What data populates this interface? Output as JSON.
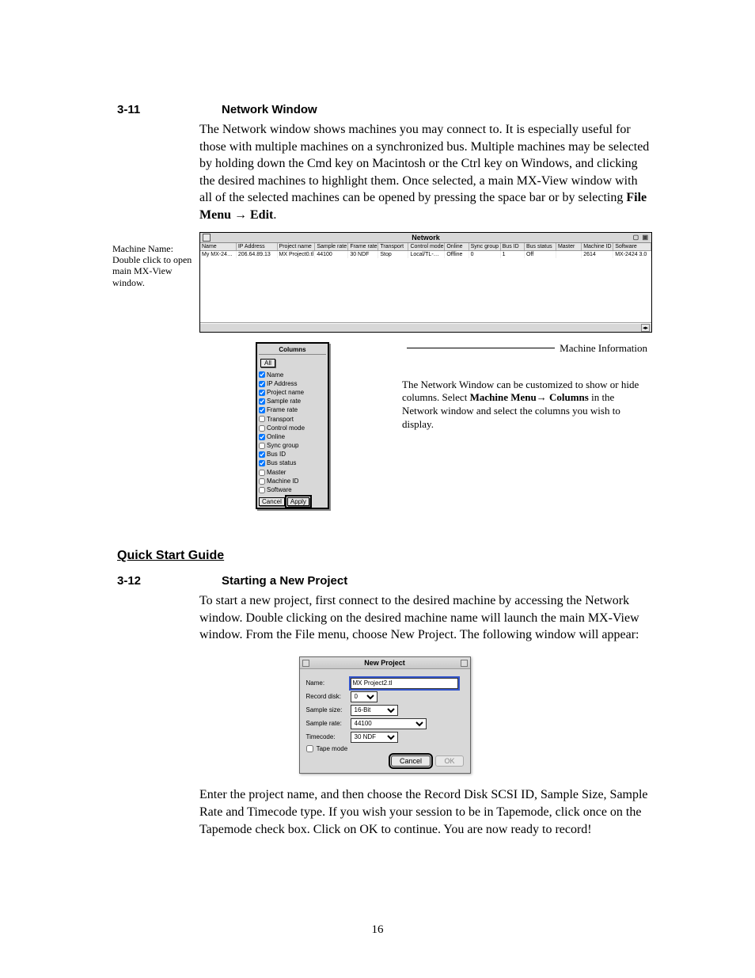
{
  "sec311": {
    "num": "3-11",
    "title": "Network Window"
  },
  "p311": "The Network window shows machines you may connect to. It is especially useful for those with multiple machines on a synchronized bus. Multiple machines may be selected by holding down the Cmd key on Macintosh or the Ctrl key on Windows, and clicking the desired machines to highlight them. Once selected, a main MX-View window with all of the selected machines can be opened by pressing the space bar or by selecting ",
  "p311_b1": "File Menu ",
  "p311_b2": " Edit",
  "arrow": "→",
  "annot": {
    "l1": "Machine Name:",
    "l2": "Double click to open",
    "l3": "main MX-View window."
  },
  "network": {
    "title": "Network",
    "headers": [
      "Name",
      "IP Address",
      "Project name",
      "Sample rate",
      "Frame rate",
      "Transport",
      "Control mode",
      "Online",
      "Sync group",
      "Bus ID",
      "Bus status",
      "Master",
      "Machine ID",
      "Software"
    ],
    "row": [
      "My MX-24…",
      "206.64.89.13",
      "MX Project0.tl",
      "44100",
      "30 NDF",
      "Stop",
      "Local/TL-…",
      "Offline",
      "0",
      "1",
      "Off",
      "",
      "2614",
      "MX-2424 3.0"
    ]
  },
  "columns": {
    "title": "Columns",
    "all": "All",
    "items": [
      {
        "label": "Name",
        "checked": true
      },
      {
        "label": "IP Address",
        "checked": true
      },
      {
        "label": "Project name",
        "checked": true
      },
      {
        "label": "Sample rate",
        "checked": true
      },
      {
        "label": "Frame rate",
        "checked": true
      },
      {
        "label": "Transport",
        "checked": false
      },
      {
        "label": "Control mode",
        "checked": false
      },
      {
        "label": "Online",
        "checked": true
      },
      {
        "label": "Sync group",
        "checked": false
      },
      {
        "label": "Bus ID",
        "checked": true
      },
      {
        "label": "Bus status",
        "checked": true
      },
      {
        "label": "Master",
        "checked": false
      },
      {
        "label": "Machine ID",
        "checked": false
      },
      {
        "label": "Software",
        "checked": false
      }
    ],
    "cancel": "Cancel",
    "apply": "Apply"
  },
  "machine_info": {
    "title": "Machine Information",
    "body_a": "The Network Window can be customized to show or hide columns. Select ",
    "body_b": "Machine Menu",
    "body_c": " Columns",
    "body_d": " in the Network window and select the columns you wish to display."
  },
  "guide_title": "Quick Start Guide",
  "sec312": {
    "num": "3-12",
    "title": "Starting a New Project"
  },
  "p312a": "To start a new project, first connect to the desired machine by accessing the Network window. Double clicking on the desired machine name will launch the main MX-View window. From the File menu, choose New Project. The following window will appear:",
  "new_project": {
    "title": "New Project",
    "name_lbl": "Name:",
    "name_val": "MX Project2.tl",
    "disk_lbl": "Record disk:",
    "disk_val": "0",
    "size_lbl": "Sample size:",
    "size_val": "16-Bit",
    "rate_lbl": "Sample rate:",
    "rate_val": "44100",
    "tc_lbl": "Timecode:",
    "tc_val": "30 NDF",
    "tape_lbl": "Tape mode",
    "cancel": "Cancel",
    "ok": "OK"
  },
  "p312b": "Enter the project name, and then choose the Record Disk SCSI ID, Sample Size, Sample Rate and Timecode type. If you wish your session to be in Tapemode, click once on the Tapemode check box. Click on OK to continue. You are now ready to record!",
  "page_num": "16"
}
